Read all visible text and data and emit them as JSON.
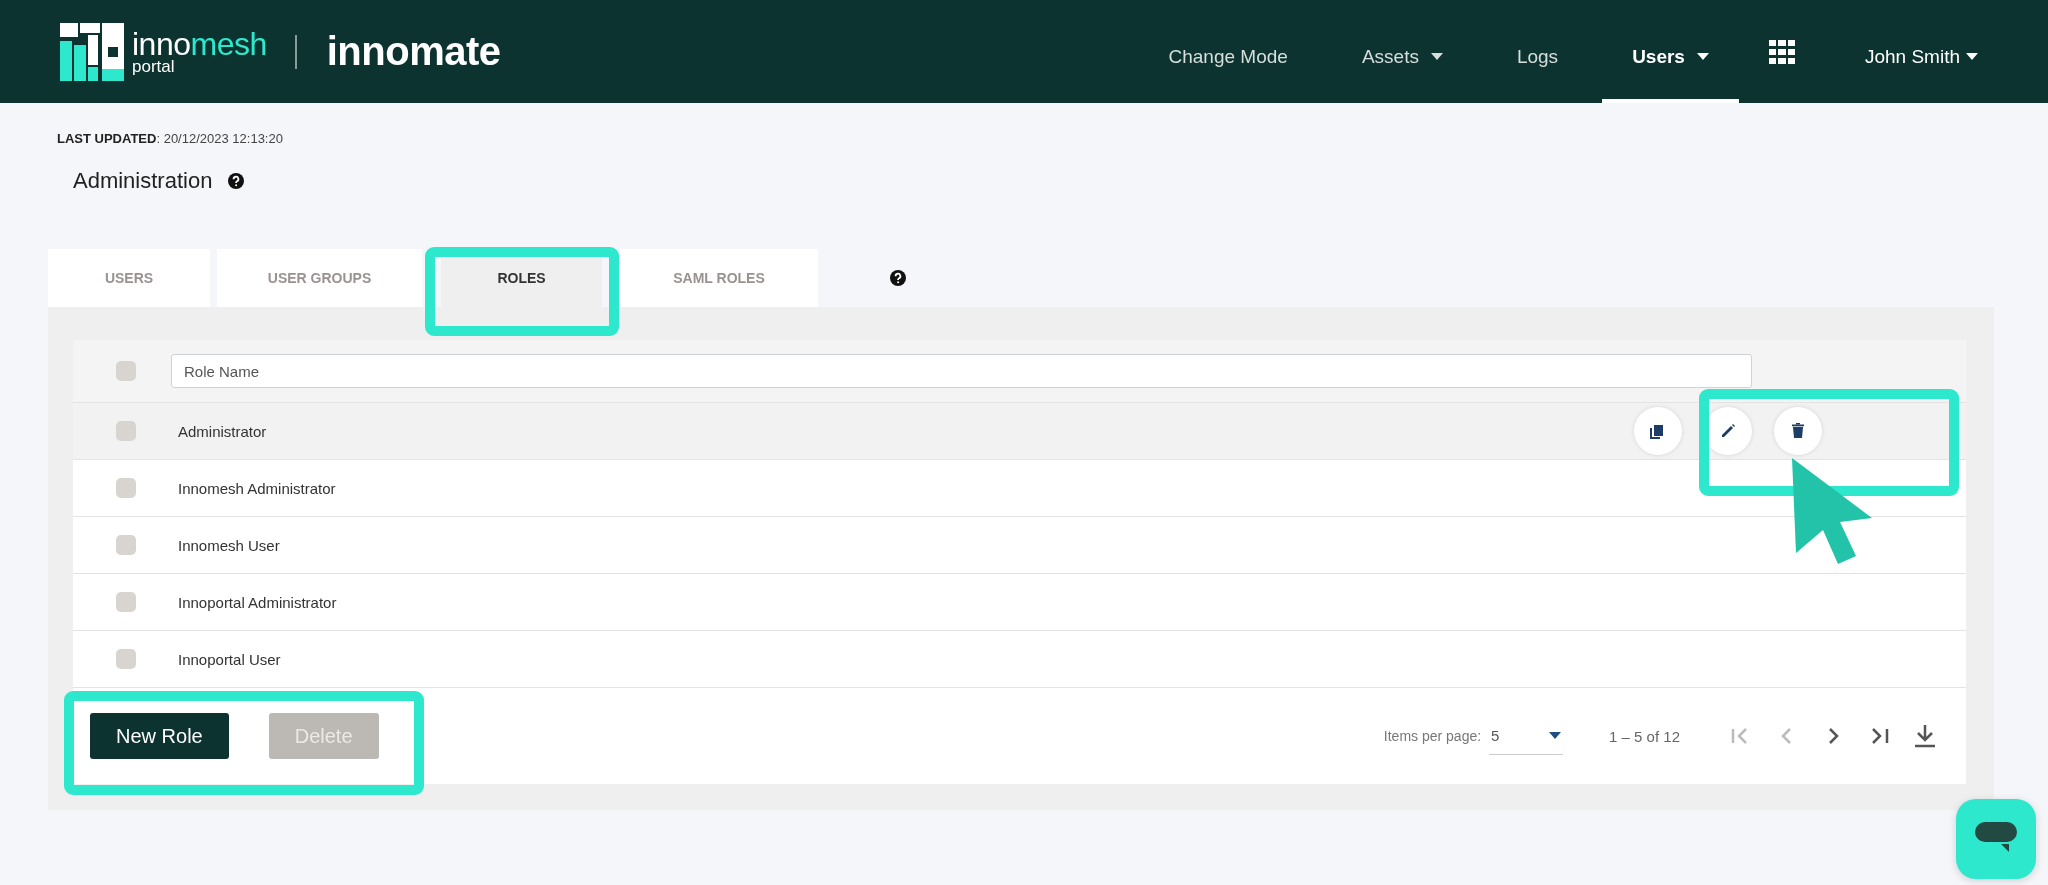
{
  "header": {
    "logo": {
      "name_start": "inno",
      "name_end": "mesh",
      "subtitle": "portal"
    },
    "app_name": "innomate",
    "nav": [
      {
        "label": "Change Mode",
        "kind": "link",
        "selected": false
      },
      {
        "label": "Assets",
        "kind": "dropdown",
        "selected": false
      },
      {
        "label": "Logs",
        "kind": "link",
        "selected": false
      },
      {
        "label": "Users",
        "kind": "dropdown",
        "selected": true
      },
      {
        "kind": "apps",
        "selected": false
      },
      {
        "label": "John Smith",
        "kind": "user",
        "selected": false
      }
    ]
  },
  "last_updated": {
    "label": "LAST UPDATED",
    "value": ": 20/12/2023 12:13:20"
  },
  "page_title": "Administration",
  "tabs": [
    {
      "label": "USERS",
      "selected": false
    },
    {
      "label": "USER GROUPS",
      "selected": false
    },
    {
      "label": "ROLES",
      "selected": true
    },
    {
      "label": "SAML ROLES",
      "selected": false
    }
  ],
  "table": {
    "header_checked": false,
    "filter": {
      "placeholder": "Role Name"
    },
    "rows": [
      {
        "name": "Administrator",
        "checked": false,
        "hovered": true
      },
      {
        "name": "Innomesh Administrator",
        "checked": false,
        "hovered": false
      },
      {
        "name": "Innomesh User",
        "checked": false,
        "hovered": false
      },
      {
        "name": "Innoportal Administrator",
        "checked": false,
        "hovered": false
      },
      {
        "name": "Innoportal User",
        "checked": false,
        "hovered": false
      }
    ]
  },
  "buttons": [
    {
      "label": "New Role",
      "disabled": false
    },
    {
      "label": "Delete",
      "disabled": true
    }
  ],
  "pagination": {
    "items_label": "Items per page:",
    "page_size": "5",
    "range": "1 – 5 of 12",
    "first_disabled": true,
    "previous_disabled": true,
    "next_disabled": false,
    "last_disabled": false
  }
}
